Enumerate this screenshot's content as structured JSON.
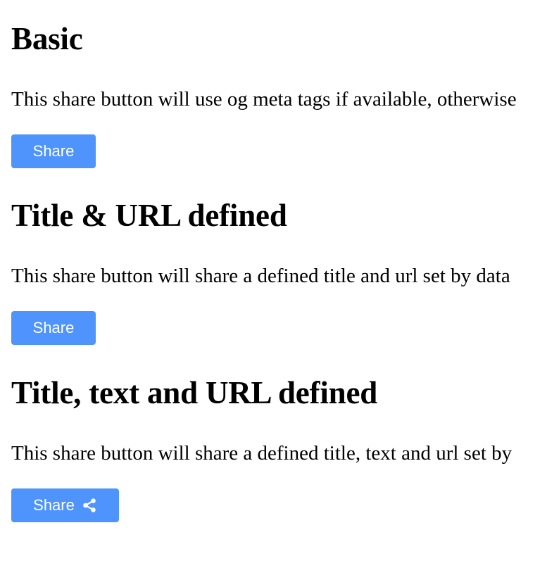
{
  "sections": [
    {
      "title": "Basic",
      "description": "This share button will use og meta tags if available, otherwise",
      "button_label": "Share",
      "has_icon": false
    },
    {
      "title": "Title & URL defined",
      "description": "This share button will share a defined title and url set by data",
      "button_label": "Share",
      "has_icon": false
    },
    {
      "title": "Title, text and URL defined",
      "description": "This share button will share a defined title, text and url set by",
      "button_label": "Share",
      "has_icon": true,
      "icon": "share-icon"
    }
  ],
  "colors": {
    "button_bg": "#4f94fd",
    "button_text": "#ffffff",
    "text": "#000000",
    "background": "#ffffff"
  }
}
